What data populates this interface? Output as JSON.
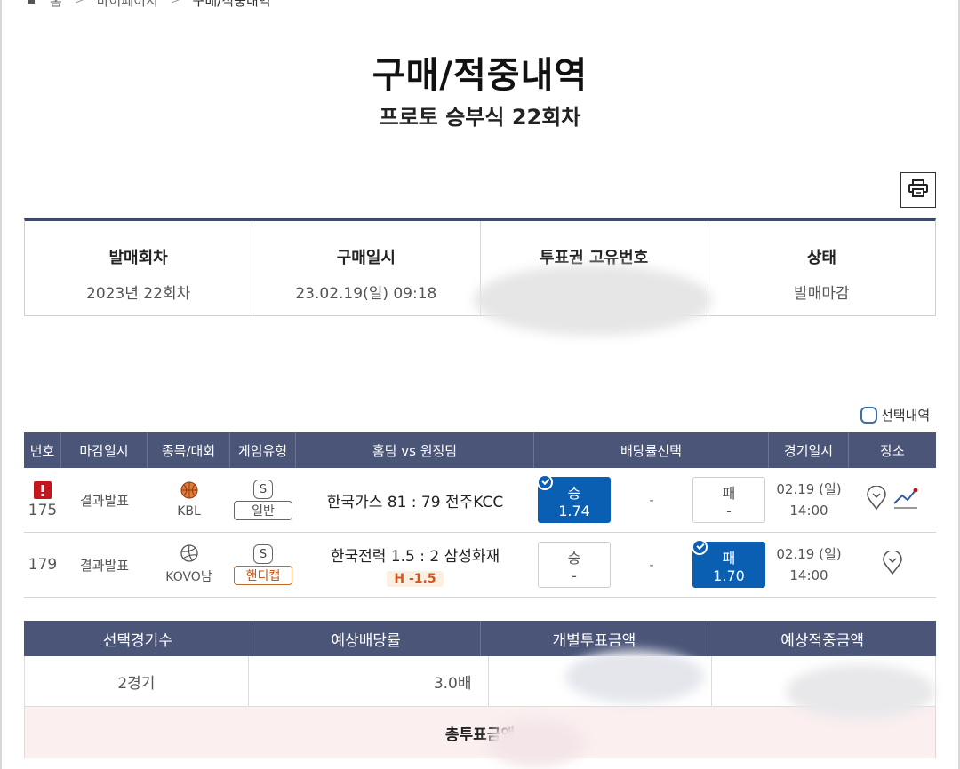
{
  "breadcrumb": {
    "home": "홈",
    "level2": "마이페이지",
    "current": "구매/적중내역"
  },
  "page": {
    "title": "구매/적중내역",
    "subtitle": "프로토 승부식 22회차"
  },
  "info": {
    "round_label": "발매회차",
    "round_value": "2023년 22회차",
    "purchase_label": "구매일시",
    "purchase_value": "23.02.19(일) 09:18",
    "ticket_label": "투표권 고유번호",
    "ticket_value": "",
    "status_label": "상태",
    "status_value": "발매마감"
  },
  "selection_toggle_label": "선택내역",
  "games_header": {
    "no": "번호",
    "close": "마감일시",
    "sport": "종목/대회",
    "type": "게임유형",
    "match": "홈팀 vs 원정팀",
    "odds": "배당률선택",
    "date": "경기일시",
    "place": "장소"
  },
  "games": [
    {
      "no": "175",
      "close": "결과발표",
      "league": "KBL",
      "type_badge": "S",
      "type": "일반",
      "match": "한국가스 81 : 79 전주KCC",
      "handicap": "",
      "win_label": "승",
      "win_odds": "1.74",
      "draw": "-",
      "lose_label": "패",
      "lose_odds": "-",
      "date": "02.19 (일)",
      "time": "14:00"
    },
    {
      "no": "179",
      "close": "결과발표",
      "league": "KOVO남",
      "type_badge": "S",
      "type": "핸디캡",
      "match": "한국전력 1.5 : 2 삼성화재",
      "handicap": "H -1.5",
      "win_label": "승",
      "win_odds": "-",
      "draw": "-",
      "lose_label": "패",
      "lose_odds": "1.70",
      "date": "02.19 (일)",
      "time": "14:00"
    }
  ],
  "summary": {
    "h_count": "선택경기수",
    "h_odds": "예상배당률",
    "h_stake": "개별투표금액",
    "h_expected": "예상적중금액",
    "count": "2경기",
    "odds": "3.0배",
    "total_label": "총투표금액"
  },
  "colors": {
    "header_bg": "#4a5578",
    "selected_blue": "#0b5fb3",
    "warning_red": "#c4161c",
    "handicap_orange": "#d2561e"
  }
}
